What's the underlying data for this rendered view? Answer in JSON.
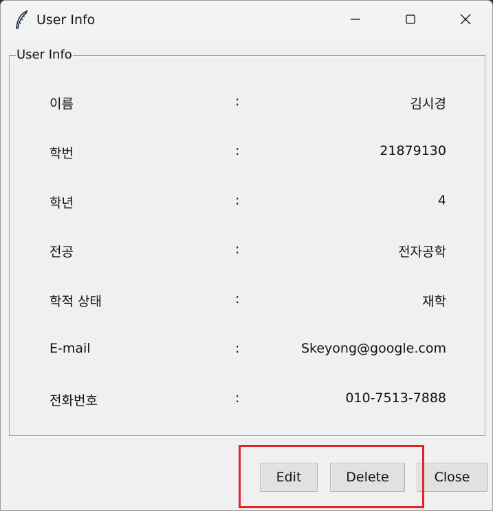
{
  "window": {
    "title": "User Info",
    "icon": "feather-icon"
  },
  "titlebar_controls": {
    "minimize_icon": "minimize-icon",
    "maximize_icon": "maximize-icon",
    "close_icon": "close-icon"
  },
  "group": {
    "legend": "User Info"
  },
  "fields": [
    {
      "label": "이름",
      "separator": ":",
      "value": "김시경"
    },
    {
      "label": "학번",
      "separator": ":",
      "value": "21879130"
    },
    {
      "label": "학년",
      "separator": ":",
      "value": "4"
    },
    {
      "label": "전공",
      "separator": ":",
      "value": "전자공학"
    },
    {
      "label": "학적 상태",
      "separator": ":",
      "value": "재학"
    },
    {
      "label": "E-mail",
      "separator": ":",
      "value": "Skeyong@google.com"
    },
    {
      "label": "전화번호",
      "separator": ":",
      "value": "010-7513-7888"
    }
  ],
  "buttons": {
    "edit": "Edit",
    "delete": "Delete",
    "close": "Close"
  },
  "colors": {
    "window_bg": "#f0f0f0",
    "highlight": "#e0242a"
  }
}
